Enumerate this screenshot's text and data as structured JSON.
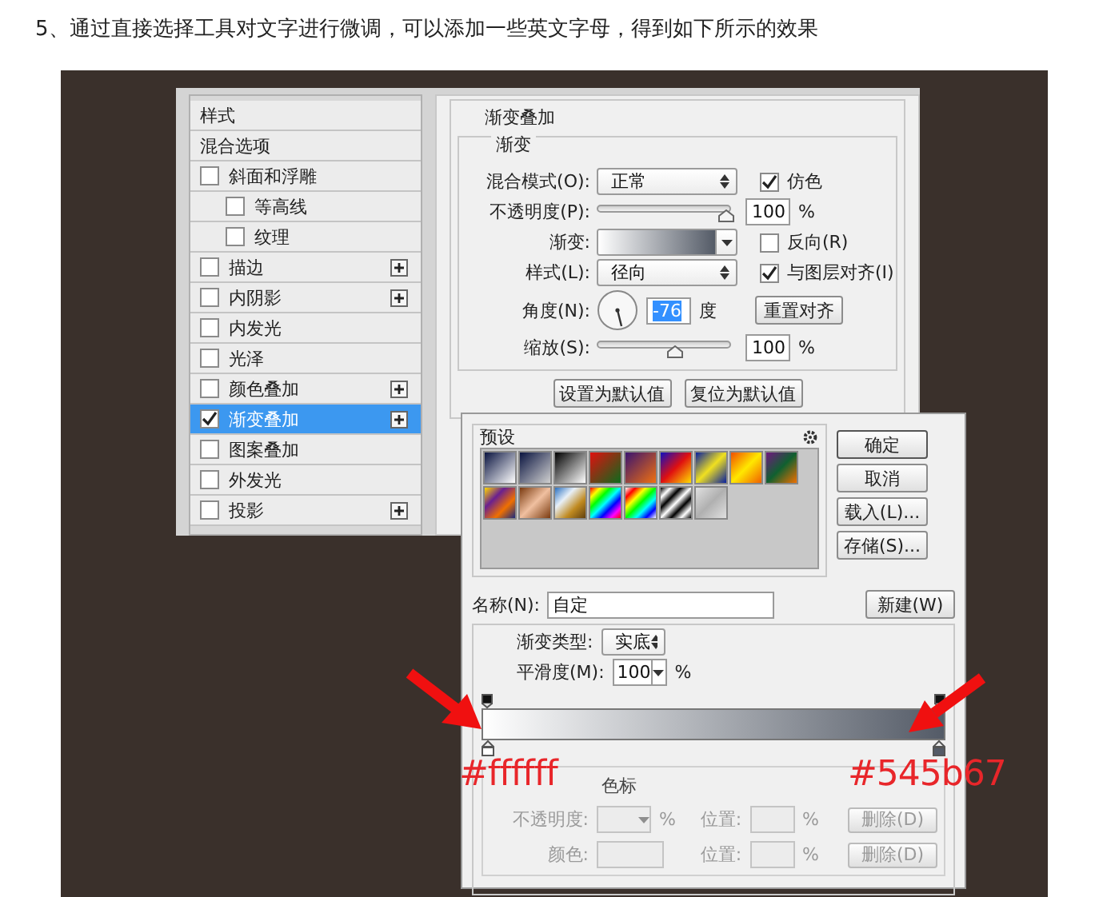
{
  "caption": "5、通过直接选择工具对文字进行微调，可以添加一些英文字母，得到如下所示的效果",
  "style_list": [
    {
      "label": "样式",
      "kind": "heading"
    },
    {
      "label": "混合选项",
      "kind": "heading"
    },
    {
      "label": "斜面和浮雕",
      "kind": "option",
      "checked": false,
      "selected": false,
      "addable": false,
      "children": [
        {
          "label": "等高线",
          "kind": "option",
          "checked": false,
          "selected": false,
          "addable": false
        },
        {
          "label": "纹理",
          "kind": "option",
          "checked": false,
          "selected": false,
          "addable": false
        }
      ]
    },
    {
      "label": "描边",
      "kind": "option",
      "checked": false,
      "selected": false,
      "addable": true
    },
    {
      "label": "内阴影",
      "kind": "option",
      "checked": false,
      "selected": false,
      "addable": true
    },
    {
      "label": "内发光",
      "kind": "option",
      "checked": false,
      "selected": false,
      "addable": false
    },
    {
      "label": "光泽",
      "kind": "option",
      "checked": false,
      "selected": false,
      "addable": false
    },
    {
      "label": "颜色叠加",
      "kind": "option",
      "checked": false,
      "selected": false,
      "addable": true
    },
    {
      "label": "渐变叠加",
      "kind": "option",
      "checked": true,
      "selected": true,
      "addable": true
    },
    {
      "label": "图案叠加",
      "kind": "option",
      "checked": false,
      "selected": false,
      "addable": false
    },
    {
      "label": "外发光",
      "kind": "option",
      "checked": false,
      "selected": false,
      "addable": false
    },
    {
      "label": "投影",
      "kind": "option",
      "checked": false,
      "selected": false,
      "addable": true
    }
  ],
  "gradient_overlay": {
    "title": "渐变叠加",
    "group_title": "渐变",
    "blend_mode": {
      "label": "混合模式(O):",
      "value": "正常"
    },
    "dither": {
      "label": "仿色",
      "checked": true
    },
    "opacity": {
      "label": "不透明度(P):",
      "level": 0.96,
      "value": "100",
      "unit": "%"
    },
    "gradient": {
      "label": "渐变:"
    },
    "reverse": {
      "label": "反向(R)",
      "checked": false
    },
    "style": {
      "label": "样式(L):",
      "value": "径向"
    },
    "align": {
      "label": "与图层对齐(I)",
      "checked": true
    },
    "angle": {
      "label": "角度(N):",
      "value": "-76",
      "unit": "度"
    },
    "reset_button": "重置对齐",
    "scale": {
      "label": "缩放(S):",
      "level": 0.58,
      "value": "100",
      "unit": "%"
    },
    "buttons": [
      "设置为默认值",
      "复位为默认值"
    ]
  },
  "gradient_editor": {
    "presets_title": "预设",
    "buttons": [
      "确定",
      "取消",
      "载入(L)...",
      "存储(S)..."
    ],
    "name": {
      "label": "名称(N):",
      "value": "自定"
    },
    "new_button": "新建(W)",
    "type": {
      "label": "渐变类型:",
      "value": "实底"
    },
    "smoothness": {
      "label": "平滑度(M):",
      "value": "100",
      "unit": "%"
    },
    "stops": [
      {
        "color": "#ffffff"
      },
      {
        "color": "#545b67"
      }
    ],
    "stops_group": {
      "title": "色标",
      "rows": [
        {
          "label": "不透明度:",
          "kind": "dropdown",
          "unit": "%",
          "position_label": "位置:",
          "position_unit": "%",
          "delete_button": "删除(D)",
          "disabled": true
        },
        {
          "label": "颜色:",
          "kind": "swatch",
          "position_label": "位置:",
          "position_unit": "%",
          "delete_button": "删除(D)",
          "disabled": true
        }
      ]
    }
  },
  "annotations": [
    {
      "text": "#ffffff"
    },
    {
      "text": "#545b67"
    }
  ]
}
